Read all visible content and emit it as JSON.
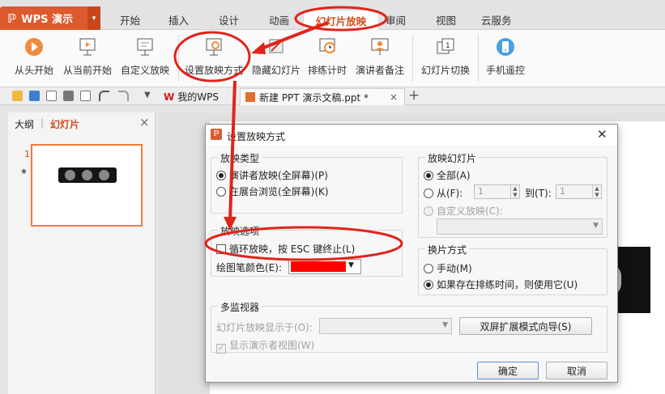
{
  "app": {
    "logo_glyph": "ℙ",
    "name": "WPS 演示",
    "menu_arrow": "▾"
  },
  "tabs": [
    "开始",
    "插入",
    "设计",
    "动画",
    "幻灯片放映",
    "审阅",
    "视图",
    "云服务"
  ],
  "ribbon": [
    "从头开始",
    "从当前开始",
    "自定义放映",
    "设置放映方式",
    "隐藏幻灯片",
    "排练计时",
    "演讲者备注",
    "幻灯片切换",
    "手机遥控"
  ],
  "doctabs": {
    "tab1": "我的WPS",
    "tab2": "新建 PPT 演示文稿.ppt *",
    "close": "×",
    "add": "+"
  },
  "leftpane": {
    "tab_outline": "大纲",
    "separator": "|",
    "tab_slides": "幻灯片",
    "close": "×",
    "slide_number": "1",
    "star": "★"
  },
  "dialog": {
    "title": "设置放映方式",
    "close": "✕",
    "type_group": {
      "title": "放映类型",
      "opt1": "演讲者放映(全屏幕)(P)",
      "opt2": "在展台浏览(全屏幕)(K)"
    },
    "slides_group": {
      "title": "放映幻灯片",
      "all": "全部(A)",
      "from": "从(F):",
      "from_val": "1",
      "to": "到(T):",
      "to_val": "1",
      "custom": "自定义放映(C):"
    },
    "options_group": {
      "title": "放映选项",
      "loop": "循环放映，按 ESC 键终止(L)",
      "pen": "绘图笔颜色(E):"
    },
    "advance_group": {
      "title": "换片方式",
      "manual": "手动(M)",
      "timing": "如果存在排练时间，则使用它(U)"
    },
    "monitor_group": {
      "title": "多监视器",
      "show_on": "幻灯片放映显示于(O):",
      "wizard": "双屏扩展模式向导(S)",
      "presenter": "显示演示者视图(W)"
    },
    "ok": "确定",
    "cancel": "取消"
  },
  "colors": {
    "accent": "#dd5a2e",
    "pen_color": "#ff0000",
    "annotation_red": "#e0241b"
  }
}
